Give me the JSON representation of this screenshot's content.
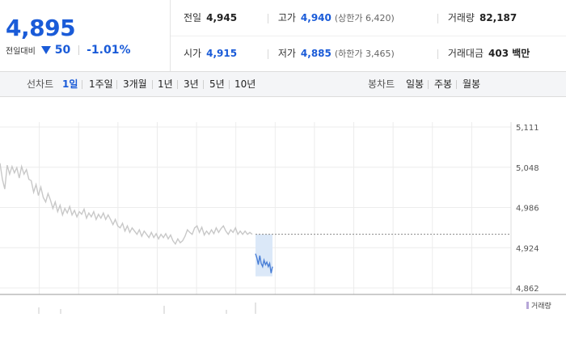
{
  "quote": {
    "current_price": "4,895",
    "change_label": "전일대비",
    "change_value": "50",
    "change_rate": "-1.01%"
  },
  "stats": {
    "prev_close": {
      "label": "전일",
      "value": "4,945"
    },
    "high": {
      "label": "고가",
      "value": "4,940",
      "note": "(상한가 6,420)"
    },
    "volume": {
      "label": "거래량",
      "value": "82,187"
    },
    "open": {
      "label": "시가",
      "value": "4,915"
    },
    "low": {
      "label": "저가",
      "value": "4,885",
      "note": "(하한가 3,465)"
    },
    "trade_value": {
      "label": "거래대금",
      "value": "403 백만"
    }
  },
  "toolbar": {
    "line_chart_label": "선차트",
    "line_periods": [
      "1일",
      "1주일",
      "3개월",
      "1년",
      "3년",
      "5년",
      "10년"
    ],
    "active_period": "1일",
    "candle_chart_label": "봉차트",
    "candle_periods": [
      "일봉",
      "주봉",
      "월봉"
    ]
  },
  "colors": {
    "price_blue": "#1a5bd8",
    "history_line": "#c8c8c8",
    "current_line": "#4a7fd6",
    "current_highlight": "#dbe8f8",
    "grid": "#ececec",
    "volume_legend": "#b6a6d8"
  },
  "chart_data": {
    "type": "line",
    "title": "",
    "xlabel": "",
    "ylabel": "",
    "ylim": [
      4862,
      5111
    ],
    "y_ticks": [
      "5,111",
      "5,048",
      "4,986",
      "4,924",
      "4,862"
    ],
    "grid": "on",
    "reference_line": {
      "name": "전일",
      "value": 4945
    },
    "series": [
      {
        "role": "previous",
        "values": [
          5055,
          5030,
          5015,
          5052,
          5038,
          5050,
          5040,
          5048,
          5032,
          5050,
          5038,
          5045,
          5030,
          5028,
          5010,
          5022,
          5005,
          5018,
          5002,
          4995,
          5008,
          4998,
          4985,
          4995,
          4980,
          4990,
          4975,
          4985,
          4978,
          4988,
          4975,
          4982,
          4972,
          4980,
          4976,
          4984,
          4970,
          4978,
          4972,
          4980,
          4968,
          4976,
          4970,
          4978,
          4968,
          4975,
          4968,
          4960,
          4968,
          4958,
          4955,
          4962,
          4950,
          4958,
          4948,
          4955,
          4950,
          4945,
          4952,
          4942,
          4950,
          4945,
          4940,
          4948,
          4940,
          4946,
          4938,
          4945,
          4940,
          4946,
          4938,
          4944,
          4935,
          4930,
          4938,
          4932,
          4935,
          4942,
          4952,
          4948,
          4945,
          4955,
          4958,
          4948,
          4956,
          4944,
          4950,
          4945,
          4952,
          4946,
          4955,
          4948,
          4954,
          4958,
          4950,
          4945,
          4952,
          4948,
          4955,
          4945,
          4950,
          4945,
          4950,
          4945,
          4948,
          4945
        ]
      },
      {
        "role": "today",
        "values": [
          4915,
          4908,
          4898,
          4912,
          4900,
          4895,
          4905,
          4898,
          4902,
          4895,
          4900,
          4885,
          4895
        ]
      }
    ],
    "volume_legend": "거래량"
  }
}
